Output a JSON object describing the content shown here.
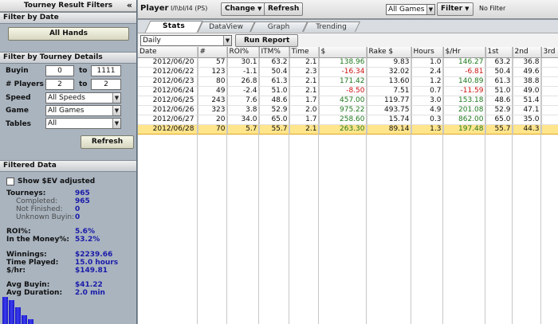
{
  "left_panel": {
    "title": "Tourney Result Filters",
    "collapse_glyph": "«",
    "filter_by_date": {
      "header": "Filter by Date",
      "all_hands_label": "All Hands"
    },
    "filter_by_tourney": {
      "header": "Filter by Tourney Details",
      "buyin_label": "Buyin",
      "buyin_from": "0",
      "buyin_to": "1111",
      "players_label": "# Players",
      "players_from": "2",
      "players_to": "2",
      "to_label": "to",
      "speed_label": "Speed",
      "speed_value": "All Speeds",
      "game_label": "Game",
      "game_value": "All Games",
      "tables_label": "Tables",
      "tables_value": "All",
      "refresh_label": "Refresh"
    },
    "filtered_data": {
      "header": "Filtered Data",
      "show_sev_label": "Show $EV adjusted",
      "tourneys_label": "Tourneys:",
      "tourneys_value": "965",
      "completed_label": "Completed:",
      "completed_value": "965",
      "not_finished_label": "Not Finished:",
      "not_finished_value": "0",
      "unknown_buyin_label": "Unknown Buyin:",
      "unknown_buyin_value": "0",
      "roi_label": "ROI%:",
      "roi_value": "5.6%",
      "itm_label": "In the Money%:",
      "itm_value": "53.2%",
      "winnings_label": "Winnings:",
      "winnings_value": "$2239.66",
      "time_played_label": "Time Played:",
      "time_played_value": "15.0 hours",
      "per_hr_label": "$/hr:",
      "per_hr_value": "$149.81",
      "avg_buyin_label": "Avg Buyin:",
      "avg_buyin_value": "$41.22",
      "avg_duration_label": "Avg Duration:",
      "avg_duration_value": "2.0 min"
    }
  },
  "toolbar": {
    "player_label": "Player",
    "player_name": "I/I\\bI/I4 (PS)",
    "change_label": "Change",
    "refresh_label": "Refresh",
    "game_filter_value": "All Games",
    "filter_label": "Filter",
    "no_filter_text": "No Filter"
  },
  "tabs": [
    {
      "label": "Stats",
      "active": true
    },
    {
      "label": "DataView",
      "active": false
    },
    {
      "label": "Graph",
      "active": false
    },
    {
      "label": "Trending",
      "active": false
    }
  ],
  "report_bar": {
    "period_value": "Daily",
    "run_report_label": "Run Report"
  },
  "table": {
    "columns": [
      "Date",
      "#",
      "ROI%",
      "ITM%",
      "Time",
      "$",
      "Rake $",
      "Hours",
      "$/Hr",
      "1st",
      "2nd",
      "3rd"
    ],
    "rows": [
      [
        "2012/06/20",
        "57",
        "30.1",
        "63.2",
        "2.1",
        "138.96",
        "9.83",
        "1.0",
        "146.27",
        "63.2",
        "36.8",
        ""
      ],
      [
        "2012/06/22",
        "123",
        "-1.1",
        "50.4",
        "2.3",
        "-16.34",
        "32.02",
        "2.4",
        "-6.81",
        "50.4",
        "49.6",
        ""
      ],
      [
        "2012/06/23",
        "80",
        "26.8",
        "61.3",
        "2.1",
        "171.42",
        "13.60",
        "1.2",
        "140.89",
        "61.3",
        "38.8",
        ""
      ],
      [
        "2012/06/24",
        "49",
        "-2.4",
        "51.0",
        "2.1",
        "-8.50",
        "7.51",
        "0.7",
        "-11.59",
        "51.0",
        "49.0",
        ""
      ],
      [
        "2012/06/25",
        "243",
        "7.6",
        "48.6",
        "1.7",
        "457.00",
        "119.77",
        "3.0",
        "153.18",
        "48.6",
        "51.4",
        ""
      ],
      [
        "2012/06/26",
        "323",
        "3.8",
        "52.9",
        "2.0",
        "975.22",
        "493.75",
        "4.9",
        "201.08",
        "52.9",
        "47.1",
        ""
      ],
      [
        "2012/06/27",
        "20",
        "34.0",
        "65.0",
        "1.7",
        "258.60",
        "15.74",
        "0.3",
        "862.00",
        "65.0",
        "35.0",
        ""
      ],
      [
        "2012/06/28",
        "70",
        "5.7",
        "55.7",
        "2.1",
        "263.30",
        "89.14",
        "1.3",
        "197.48",
        "55.7",
        "44.3",
        ""
      ]
    ],
    "selected_row": 7
  },
  "colors": {
    "positive": "#1f7a1f",
    "negative": "#cc1111",
    "selected_row": "#ffe58c",
    "stat_value": "#1a1aa8",
    "bar": "#2a2ad8"
  }
}
